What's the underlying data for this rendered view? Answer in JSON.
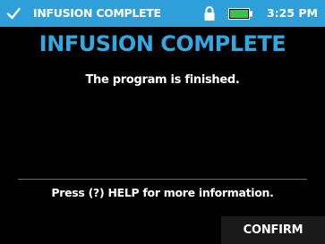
{
  "status_bar": {
    "title": "INFUSION COMPLETE",
    "time": "3:25 PM",
    "icons": [
      "check-icon",
      "lock-icon",
      "battery-icon"
    ],
    "battery_level": 1.0,
    "background_color": "#2f9fd9"
  },
  "main": {
    "heading": "INFUSION COMPLETE",
    "heading_color": "#34a7e0",
    "message": "The program is finished.",
    "help_text": "Press (?) HELP for more information."
  },
  "softkeys": {
    "confirm_label": "CONFIRM"
  }
}
